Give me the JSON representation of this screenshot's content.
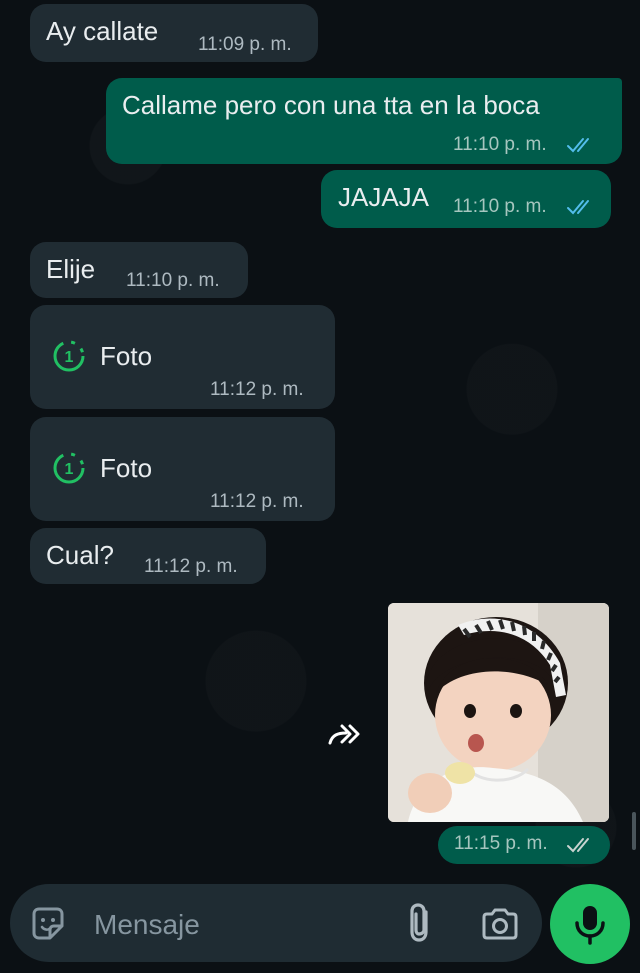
{
  "colors": {
    "incoming_bubble": "#202c33",
    "outgoing_bubble": "#005c4b",
    "accent_green": "#21c063",
    "read_ticks": "#53bdeb"
  },
  "messages": [
    {
      "direction": "incoming",
      "text": "Ay callate",
      "time": "11:09 p. m."
    },
    {
      "direction": "outgoing",
      "text": "Callame pero con una tta en la boca",
      "time": "11:10 p. m.",
      "status": "read"
    },
    {
      "direction": "outgoing",
      "text": "JAJAJA",
      "time": "11:10 p. m.",
      "status": "read"
    },
    {
      "direction": "incoming",
      "text": "Elije",
      "time": "11:10 p. m."
    },
    {
      "direction": "incoming",
      "type": "view-once-photo",
      "icon_digit": "1",
      "text": "Foto",
      "time": "11:12 p. m."
    },
    {
      "direction": "incoming",
      "type": "view-once-photo",
      "icon_digit": "1",
      "text": "Foto",
      "time": "11:12 p. m."
    },
    {
      "direction": "incoming",
      "text": "Cual?",
      "time": "11:12 p. m."
    },
    {
      "direction": "outgoing",
      "type": "sticker-image",
      "time": "11:15 p. m.",
      "status": "delivered"
    }
  ],
  "composer": {
    "placeholder": "Mensaje",
    "icons": [
      "sticker-icon",
      "attach-icon",
      "camera-icon",
      "mic-icon"
    ]
  }
}
